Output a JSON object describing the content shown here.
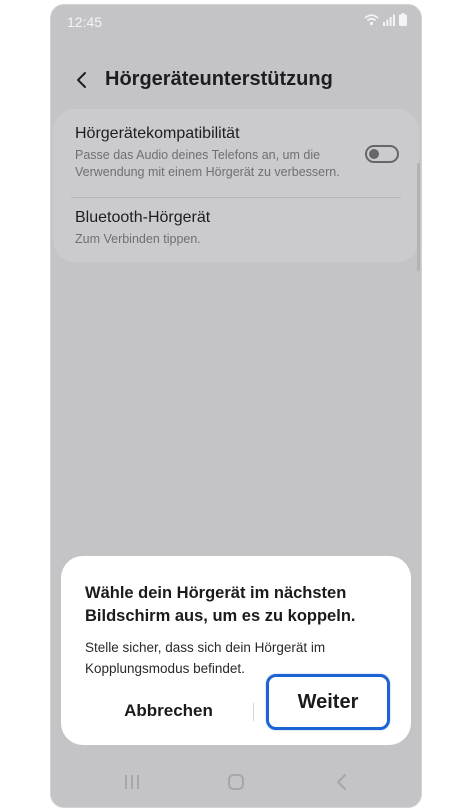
{
  "status_bar": {
    "time": "12:45"
  },
  "header": {
    "title": "Hörgeräteunterstützung"
  },
  "settings": [
    {
      "title": "Hörgerätekompatibilität",
      "subtitle": "Passe das Audio deines Telefons an, um die Verwendung mit einem Hörgerät zu verbessern.",
      "toggle_on": false
    },
    {
      "title": "Bluetooth-Hörgerät",
      "subtitle": "Zum Verbinden tippen."
    }
  ],
  "dialog": {
    "title": "Wähle dein Hörgerät im nächsten Bildschirm aus, um es zu koppeln.",
    "body": "Stelle sicher, dass sich dein Hörgerät im Kopplungsmodus befindet.",
    "cancel_label": "Abbrechen",
    "next_label": "Weiter"
  },
  "colors": {
    "highlight": "#1d64d2",
    "dim_background": "#c4c4c7"
  },
  "icons": {
    "wifi": "wifi-icon",
    "signal": "signal-icon",
    "battery": "battery-icon",
    "back": "chevron-left-icon",
    "recent": "recent-apps-icon",
    "home": "home-icon",
    "nav_back": "nav-back-icon"
  }
}
